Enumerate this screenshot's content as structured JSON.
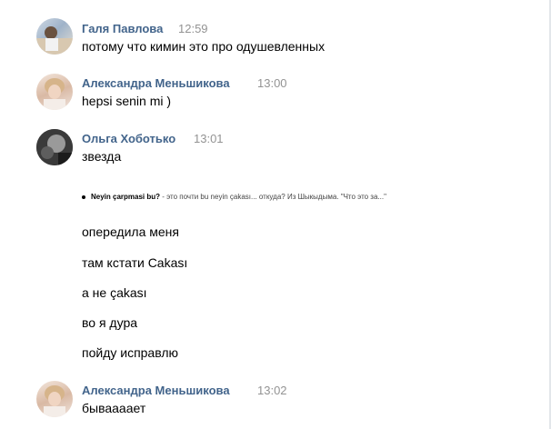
{
  "messages": [
    {
      "author": "Галя Павлова",
      "time": "12:59",
      "lines": [
        "потому что кимин это про одушевленных"
      ]
    },
    {
      "author": "Александра Меньшикова",
      "time": "13:00",
      "lines": [
        "hepsi senin mi )"
      ]
    },
    {
      "author": "Ольга Хоботько",
      "time": "13:01",
      "lines": [
        "звезда"
      ],
      "quote_bold": "Neyin çarpmasi bu?",
      "quote_rest": " - это почти bu neyin çakası... откуда? Из Шыкыдыма. \"Что это за...\"",
      "more_lines": [
        "опередила меня",
        "там кстати Cakası",
        "а не çakası",
        "во я дура",
        "пойду исправлю"
      ]
    },
    {
      "author": "Александра Меньшикова",
      "time": "13:02",
      "lines": [
        "бываааает"
      ]
    }
  ]
}
